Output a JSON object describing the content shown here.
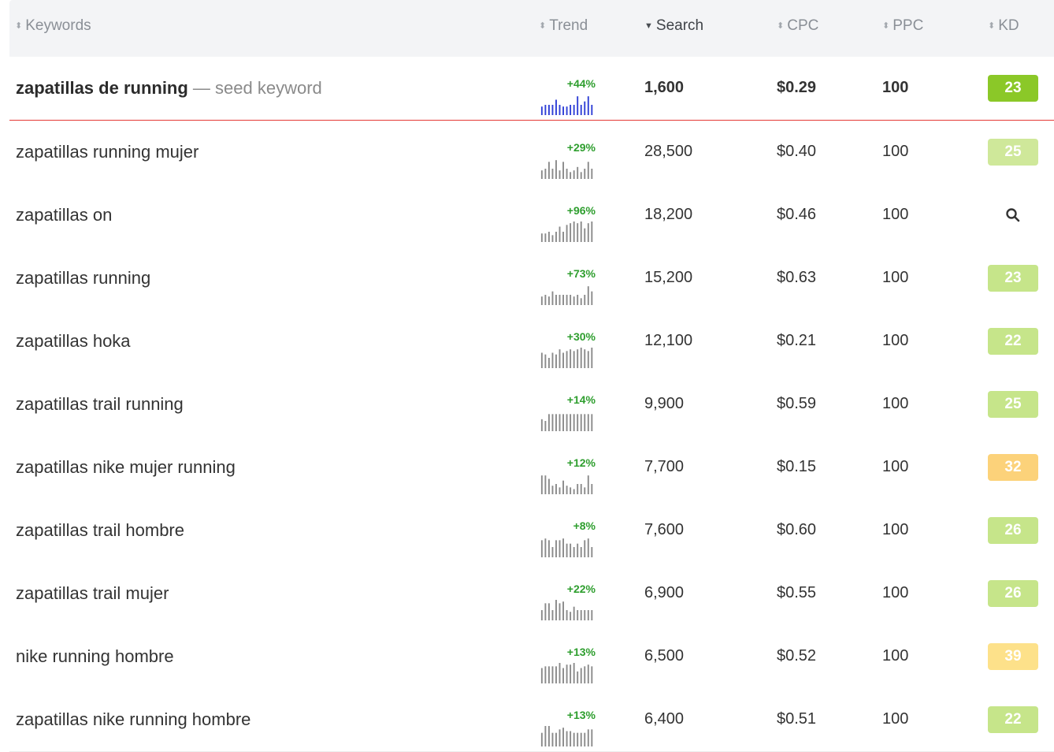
{
  "headers": {
    "keywords": "Keywords",
    "trend": "Trend",
    "search": "Search",
    "cpc": "CPC",
    "ppc": "PPC",
    "kd": "KD"
  },
  "sort_glyphs": {
    "inactive": "⬍",
    "active": "▼"
  },
  "seed": {
    "keyword": "zapatillas de running",
    "suffix": " — seed keyword",
    "trend_pct": "+44%",
    "trend_bars": [
      5,
      6,
      6,
      6,
      9,
      6,
      5,
      5,
      6,
      6,
      11,
      6,
      8,
      11,
      6
    ],
    "trend_color": "#2f3fd6",
    "search": "1,600",
    "cpc": "$0.29",
    "ppc": "100",
    "kd": "23",
    "kd_color": "#8bc828"
  },
  "rows": [
    {
      "keyword": "zapatillas running mujer",
      "trend_pct": "+29%",
      "trend_bars": [
        5,
        6,
        10,
        6,
        11,
        5,
        10,
        6,
        4,
        5,
        7,
        4,
        6,
        10,
        6
      ],
      "search": "28,500",
      "cpc": "$0.40",
      "ppc": "100",
      "kd": "25",
      "kd_color": "#cfe89a"
    },
    {
      "keyword": "zapatillas on",
      "trend_pct": "+96%",
      "trend_bars": [
        5,
        5,
        6,
        4,
        6,
        9,
        6,
        10,
        11,
        12,
        11,
        12,
        8,
        11,
        12
      ],
      "search": "18,200",
      "cpc": "$0.46",
      "ppc": "100",
      "kd": "",
      "kd_icon": "search-icon"
    },
    {
      "keyword": "zapatillas running",
      "trend_pct": "+73%",
      "trend_bars": [
        5,
        6,
        5,
        8,
        6,
        6,
        6,
        6,
        6,
        5,
        6,
        4,
        6,
        11,
        8
      ],
      "search": "15,200",
      "cpc": "$0.63",
      "ppc": "100",
      "kd": "23",
      "kd_color": "#c6e58a"
    },
    {
      "keyword": "zapatillas hoka",
      "trend_pct": "+30%",
      "trend_bars": [
        9,
        8,
        6,
        9,
        8,
        11,
        9,
        10,
        11,
        10,
        11,
        12,
        11,
        10,
        12
      ],
      "search": "12,100",
      "cpc": "$0.21",
      "ppc": "100",
      "kd": "22",
      "kd_color": "#c6e58a"
    },
    {
      "keyword": "zapatillas trail running",
      "trend_pct": "+14%",
      "trend_bars": [
        7,
        6,
        10,
        10,
        10,
        10,
        10,
        10,
        10,
        10,
        10,
        10,
        10,
        10,
        10
      ],
      "search": "9,900",
      "cpc": "$0.59",
      "ppc": "100",
      "kd": "25",
      "kd_color": "#c6e58a"
    },
    {
      "keyword": "zapatillas nike mujer running",
      "trend_pct": "+12%",
      "trend_bars": [
        11,
        11,
        9,
        5,
        6,
        4,
        8,
        5,
        4,
        3,
        6,
        6,
        4,
        11,
        6
      ],
      "search": "7,700",
      "cpc": "$0.15",
      "ppc": "100",
      "kd": "32",
      "kd_color": "#fcd27a"
    },
    {
      "keyword": "zapatillas trail hombre",
      "trend_pct": "+8%",
      "trend_bars": [
        10,
        11,
        10,
        6,
        10,
        10,
        11,
        8,
        8,
        6,
        8,
        6,
        10,
        11,
        6
      ],
      "search": "7,600",
      "cpc": "$0.60",
      "ppc": "100",
      "kd": "26",
      "kd_color": "#c6e58a"
    },
    {
      "keyword": "zapatillas trail mujer",
      "trend_pct": "+22%",
      "trend_bars": [
        6,
        10,
        10,
        6,
        12,
        10,
        11,
        6,
        5,
        8,
        6,
        6,
        6,
        6,
        6
      ],
      "search": "6,900",
      "cpc": "$0.55",
      "ppc": "100",
      "kd": "26",
      "kd_color": "#c6e58a"
    },
    {
      "keyword": "nike running hombre",
      "trend_pct": "+13%",
      "trend_bars": [
        9,
        10,
        10,
        10,
        10,
        12,
        9,
        11,
        11,
        12,
        7,
        9,
        10,
        11,
        10
      ],
      "search": "6,500",
      "cpc": "$0.52",
      "ppc": "100",
      "kd": "39",
      "kd_color": "#fde18a"
    },
    {
      "keyword": "zapatillas nike running hombre",
      "trend_pct": "+13%",
      "trend_bars": [
        8,
        12,
        12,
        8,
        8,
        10,
        11,
        9,
        9,
        8,
        8,
        8,
        8,
        10,
        10
      ],
      "search": "6,400",
      "cpc": "$0.51",
      "ppc": "100",
      "kd": "22",
      "kd_color": "#c6e58a"
    }
  ],
  "trend_color_default": "#8a8a8a"
}
